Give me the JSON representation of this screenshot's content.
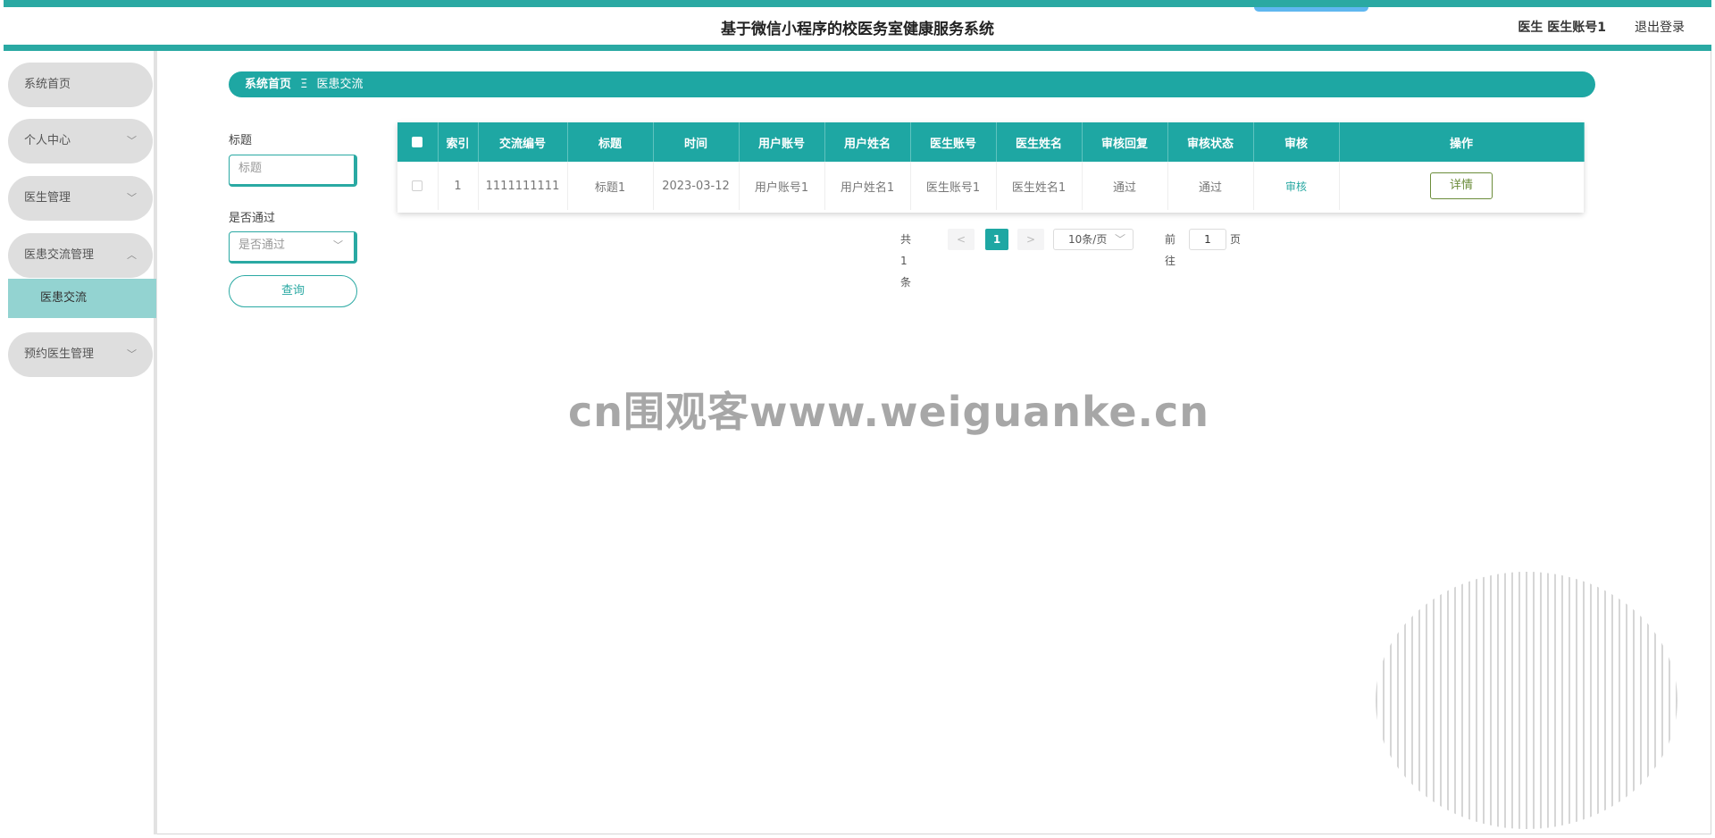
{
  "header": {
    "title": "基于微信小程序的校医务室健康服务系统",
    "user": "医生 医生账号1",
    "logout": "退出登录"
  },
  "sidebar": {
    "items": [
      {
        "label": "系统首页",
        "chevron": ""
      },
      {
        "label": "个人中心",
        "chevron": "﹀"
      },
      {
        "label": "医生管理",
        "chevron": "﹀"
      },
      {
        "label": "医患交流管理",
        "chevron": "︿"
      },
      {
        "label": "预约医生管理",
        "chevron": "﹀"
      }
    ],
    "active_sub": "医患交流"
  },
  "breadcrumb": {
    "home": "系统首页",
    "separator": "Ξ",
    "current": "医患交流"
  },
  "search": {
    "title_label": "标题",
    "title_placeholder": "标题",
    "approved_label": "是否通过",
    "approved_placeholder": "是否通过",
    "query_button": "查询"
  },
  "table": {
    "headers": [
      "索引",
      "交流编号",
      "标题",
      "时间",
      "用户账号",
      "用户姓名",
      "医生账号",
      "医生姓名",
      "审核回复",
      "审核状态",
      "审核",
      "操作"
    ],
    "rows": [
      {
        "index": "1",
        "code": "1111111111",
        "title": "标题1",
        "time": "2023-03-12",
        "user_account": "用户账号1",
        "user_name": "用户姓名1",
        "doctor_account": "医生账号1",
        "doctor_name": "医生姓名1",
        "audit_reply": "通过",
        "audit_status": "通过",
        "audit_action": "审核",
        "operation": "详情"
      }
    ]
  },
  "pagination": {
    "total": "共 1 条",
    "prev": "<",
    "page": "1",
    "next": ">",
    "page_size": "10条/页",
    "goto_label": "前往",
    "goto_value": "1",
    "goto_suffix": "页"
  },
  "watermark": "cn围观客www.weiguanke.cn",
  "colors": {
    "accent": "#1ea7a3",
    "submenu_active": "#93d3d1",
    "menu_bg": "#dedede",
    "detail_button": "#6b8c3a"
  }
}
